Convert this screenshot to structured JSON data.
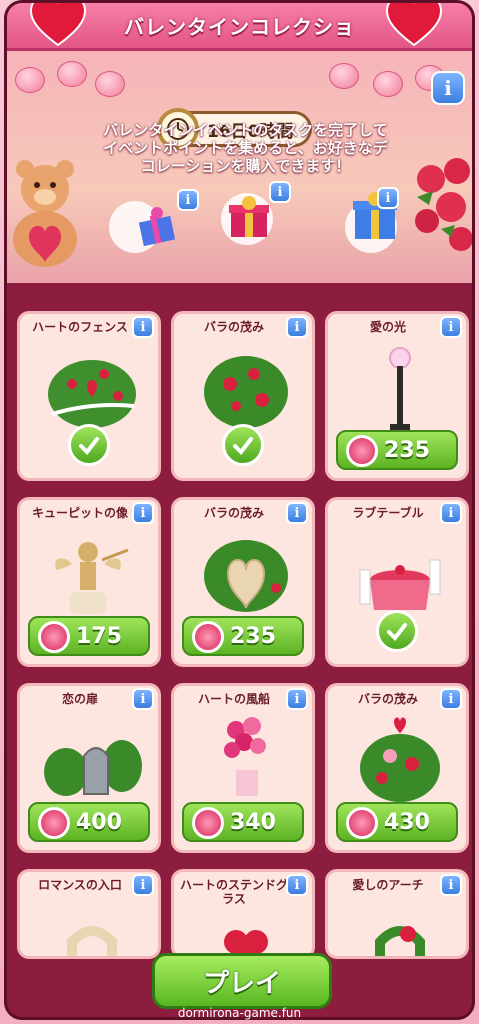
{
  "header": {
    "title": "バレンタインコレクショ"
  },
  "timer": {
    "text": "16日0時間"
  },
  "banner": {
    "description": "バレンタインイベントのタスクを完了して\nイベントポイントを集めると、お好きなデ\nコレーションを購入できます！",
    "progress": 0.18
  },
  "info_label": "i",
  "items": [
    {
      "label": "ハートのフェンス",
      "status": "owned"
    },
    {
      "label": "バラの茂み",
      "status": "owned"
    },
    {
      "label": "愛の光",
      "status": "price",
      "price": "235"
    },
    {
      "label": "キューピットの像",
      "status": "price",
      "price": "175"
    },
    {
      "label": "バラの茂み",
      "status": "price",
      "price": "235"
    },
    {
      "label": "ラブテーブル",
      "status": "owned"
    },
    {
      "label": "恋の扉",
      "status": "price",
      "price": "400"
    },
    {
      "label": "ハートの風船",
      "status": "price",
      "price": "340"
    },
    {
      "label": "バラの茂み",
      "status": "price",
      "price": "430"
    },
    {
      "label": "ロマンスの入口",
      "status": "partial"
    },
    {
      "label": "ハートのステンドグラス",
      "status": "partial"
    },
    {
      "label": "愛しのアーチ",
      "status": "partial"
    }
  ],
  "play_button": {
    "label": "プレイ"
  },
  "watermark": {
    "text": "dormirona-game.fun"
  },
  "colors": {
    "accent": "#e25686",
    "frame": "#8c1d3f",
    "button": "#5db324",
    "info": "#3b7ee0"
  },
  "icons": [
    "heart-balloon-icon",
    "clock-icon",
    "info-icon",
    "gift-icon",
    "check-icon",
    "heart-coin-icon"
  ]
}
